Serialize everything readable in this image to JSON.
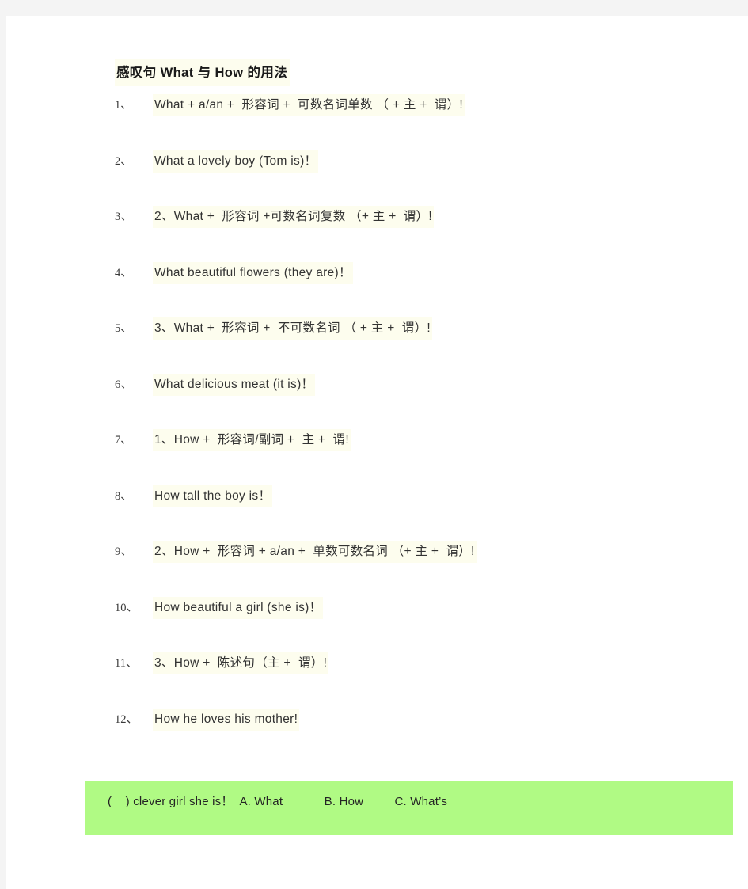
{
  "document": {
    "title": "感叹句 What  与 How 的用法",
    "items": [
      {
        "num": "1、",
        "text": "What + a/an +  形容词 +  可数名词单数 （ + 主 +  谓）!"
      },
      {
        "num": "2、",
        "text": "What a lovely boy (Tom is)！"
      },
      {
        "num": "3、",
        "text": "2、What +  形容词 +可数名词复数 （+ 主 +  谓）!"
      },
      {
        "num": "4、",
        "text": "What beautiful flowers (they are)！"
      },
      {
        "num": "5、",
        "text": "3、What +  形容词 +  不可数名词 （ + 主 +  谓）!"
      },
      {
        "num": "6、",
        "text": "What delicious meat (it is)！"
      },
      {
        "num": "7、",
        "text": "1、How +  形容词/副词 +  主 +  谓!"
      },
      {
        "num": "8、",
        "text": "How tall the boy is！"
      },
      {
        "num": "9、",
        "text": "2、How +  形容词 + a/an +  单数可数名词 （+ 主 +  谓）!"
      },
      {
        "num": "10、",
        "text": "How beautiful a girl (she is)！"
      },
      {
        "num": "11、",
        "text": "3、How +  陈述句（主 +  谓）!"
      },
      {
        "num": "12、",
        "text": "How he loves his mother!"
      }
    ],
    "quiz": {
      "text": "(    ) clever girl she is！  A. What            B. How         C. What’s",
      "background_color": "#b0fa84"
    },
    "colors": {
      "page_background": "#ffffff",
      "chrome_background": "#f4f4f4",
      "text": "#333333",
      "title": "#1a1a1a",
      "highlight": "#fdfdee",
      "quiz_highlight": "#b0fa84"
    }
  }
}
